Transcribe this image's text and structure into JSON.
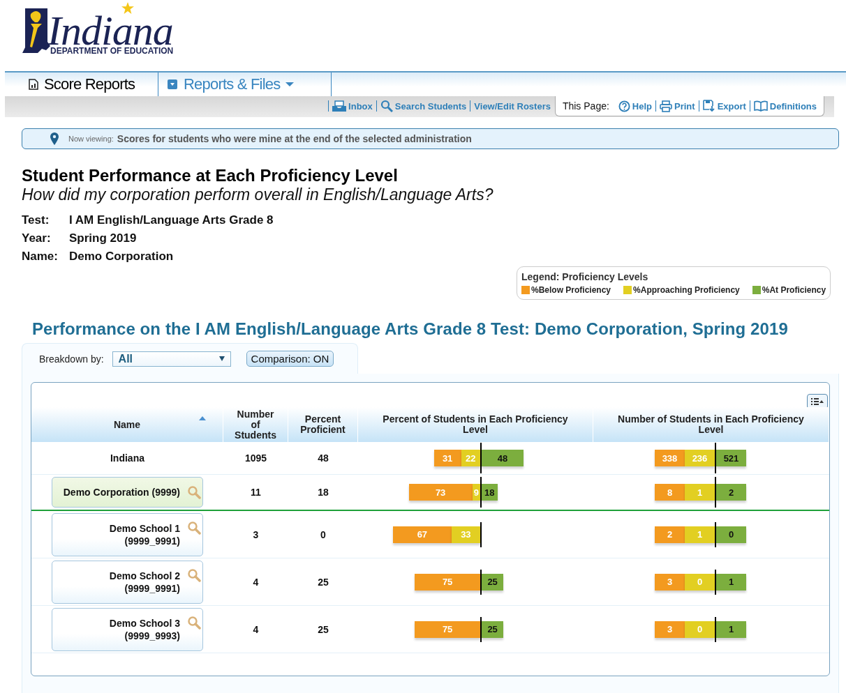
{
  "logo": {
    "name": "Indiana",
    "subtitle": "DEPARTMENT OF EDUCATION"
  },
  "tabs": [
    {
      "label": "Score Reports",
      "selected": true
    },
    {
      "label": "Reports & Files",
      "selected": false
    }
  ],
  "toolbar_links": [
    "Inbox",
    "Search Students",
    "View/Edit Rosters"
  ],
  "page_tools": {
    "label": "This Page:",
    "links": [
      "Help",
      "Print",
      "Export",
      "Definitions"
    ]
  },
  "now_viewing": {
    "label": "Now viewing:",
    "text": "Scores for students who were mine at the end of the selected administration"
  },
  "title": "Student Performance at Each Proficiency Level",
  "subtitle": "How did my corporation perform overall in English/Language Arts?",
  "details": [
    {
      "label": "Test:",
      "value": "I AM English/Language Arts Grade 8"
    },
    {
      "label": "Year:",
      "value": "Spring 2019"
    },
    {
      "label": "Name:",
      "value": "Demo Corporation"
    }
  ],
  "legend": {
    "title": "Legend: Proficiency Levels",
    "items": [
      {
        "kind": "below",
        "label": "%Below Proficiency"
      },
      {
        "kind": "approaching",
        "label": "%Approaching Proficiency"
      },
      {
        "kind": "at",
        "label": "%At Proficiency"
      }
    ]
  },
  "report_title": "Performance on the I AM English/Language Arts Grade 8 Test: Demo Corporation, Spring 2019",
  "breakdown": {
    "label": "Breakdown by:",
    "value": "All"
  },
  "comparison_button": "Comparison: ON",
  "table": {
    "columns": [
      "Name",
      "Number of Students",
      "Percent Proficient",
      "Percent of Students in Each Proficiency Level",
      "Number of Students in Each Proficiency Level"
    ],
    "rows": [
      {
        "kind": "state",
        "name": "Indiana",
        "students": "1095",
        "proficient": "48",
        "percent_bar": [
          {
            "kind": "below",
            "value": "31"
          },
          {
            "kind": "approaching",
            "value": "22"
          },
          {
            "kind": "at",
            "value": "48"
          }
        ],
        "number_bar": [
          {
            "kind": "below",
            "value": "338"
          },
          {
            "kind": "approaching",
            "value": "236"
          },
          {
            "kind": "at",
            "value": "521"
          }
        ]
      },
      {
        "kind": "corporation",
        "name": "Demo Corporation (9999)",
        "students": "11",
        "proficient": "18",
        "percent_bar": [
          {
            "kind": "below",
            "value": "73"
          },
          {
            "kind": "approaching",
            "value": "9"
          },
          {
            "kind": "at",
            "value": "18"
          }
        ],
        "number_bar": [
          {
            "kind": "below",
            "value": "8"
          },
          {
            "kind": "approaching",
            "value": "1"
          },
          {
            "kind": "at",
            "value": "2"
          }
        ]
      },
      {
        "kind": "school",
        "name": "Demo School 1",
        "code": "(9999_9991)",
        "students": "3",
        "proficient": "0",
        "percent_bar": [
          {
            "kind": "below",
            "value": "67"
          },
          {
            "kind": "approaching",
            "value": "33"
          }
        ],
        "number_bar": [
          {
            "kind": "below",
            "value": "2"
          },
          {
            "kind": "approaching",
            "value": "1"
          },
          {
            "kind": "at",
            "value": "0"
          }
        ]
      },
      {
        "kind": "school",
        "name": "Demo School 2",
        "code": "(9999_9991)",
        "students": "4",
        "proficient": "25",
        "percent_bar": [
          {
            "kind": "below",
            "value": "75"
          },
          {
            "kind": "at",
            "value": "25"
          }
        ],
        "number_bar": [
          {
            "kind": "below",
            "value": "3"
          },
          {
            "kind": "approaching",
            "value": "0"
          },
          {
            "kind": "at",
            "value": "1"
          }
        ]
      },
      {
        "kind": "school",
        "name": "Demo School 3",
        "code": "(9999_9993)",
        "students": "4",
        "proficient": "25",
        "percent_bar": [
          {
            "kind": "below",
            "value": "75"
          },
          {
            "kind": "at",
            "value": "25"
          }
        ],
        "number_bar": [
          {
            "kind": "below",
            "value": "3"
          },
          {
            "kind": "approaching",
            "value": "0"
          },
          {
            "kind": "at",
            "value": "1"
          }
        ]
      }
    ]
  }
}
